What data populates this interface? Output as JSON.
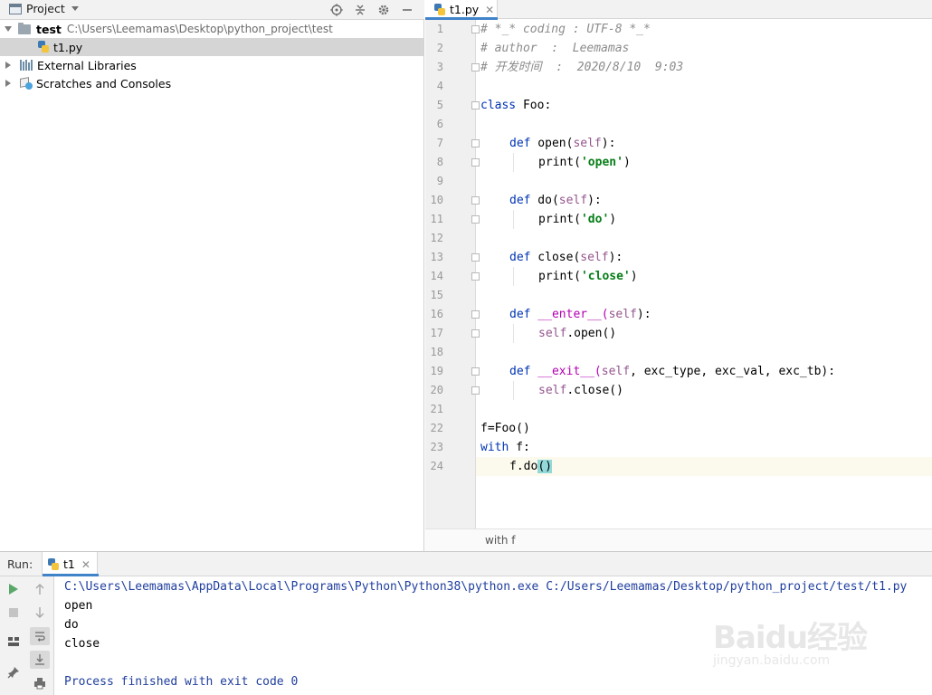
{
  "project_panel": {
    "title": "Project",
    "tools": [
      "crosshair-icon",
      "collapse-icon",
      "gear-icon",
      "minimize-icon"
    ],
    "tree": {
      "root_name": "test",
      "root_path": "C:\\Users\\Leemamas\\Desktop\\python_project\\test",
      "file": "t1.py",
      "external_libraries": "External Libraries",
      "scratches": "Scratches and Consoles"
    }
  },
  "editor": {
    "tab_label": "t1.py",
    "breadcrumb": "with f",
    "line_numbers": [
      "1",
      "2",
      "3",
      "4",
      "5",
      "6",
      "7",
      "8",
      "9",
      "10",
      "11",
      "12",
      "13",
      "14",
      "15",
      "16",
      "17",
      "18",
      "19",
      "20",
      "21",
      "22",
      "23",
      "24"
    ],
    "code": {
      "l1": "# *_* coding : UTF-8 *_*",
      "l2": "# author  :  Leemamas",
      "l3": "# 开发时间  :  2020/8/10  9:03",
      "l5_kw": "class",
      "l5_rest": " Foo:",
      "def": "def",
      "print": "print",
      "self": "self",
      "l7_name": " open(",
      "l7_end": "):",
      "l8_str": "'open'",
      "l10_name": " do(",
      "l11_str": "'do'",
      "l13_name": " close(",
      "l14_str": "'close'",
      "l16_name": " __enter__(",
      "l17_rest": ".open()",
      "l19_name": " __exit__(",
      "l19_rest": ", exc_type, exc_val, exc_tb):",
      "l20_rest": ".close()",
      "l22": "f=Foo()",
      "l23_kw": "with",
      "l23_rest": " f:",
      "l24_pre": "f.do",
      "l24_paren": "()"
    }
  },
  "run_panel": {
    "label": "Run:",
    "tab_label": "t1",
    "console": [
      "C:\\Users\\Leemamas\\AppData\\Local\\Programs\\Python\\Python38\\python.exe C:/Users/Leemamas/Desktop/python_project/test/t1.py",
      "open",
      "do",
      "close",
      "",
      "Process finished with exit code 0"
    ]
  },
  "watermark": {
    "top": "Baidu经验",
    "bottom": "jingyan.baidu.com"
  },
  "colors": {
    "keyword": "#0033b3",
    "self": "#94558d",
    "string": "#067d17",
    "comment": "#8c8c8c",
    "accent": "#4083c9",
    "run_green": "#59a869"
  }
}
